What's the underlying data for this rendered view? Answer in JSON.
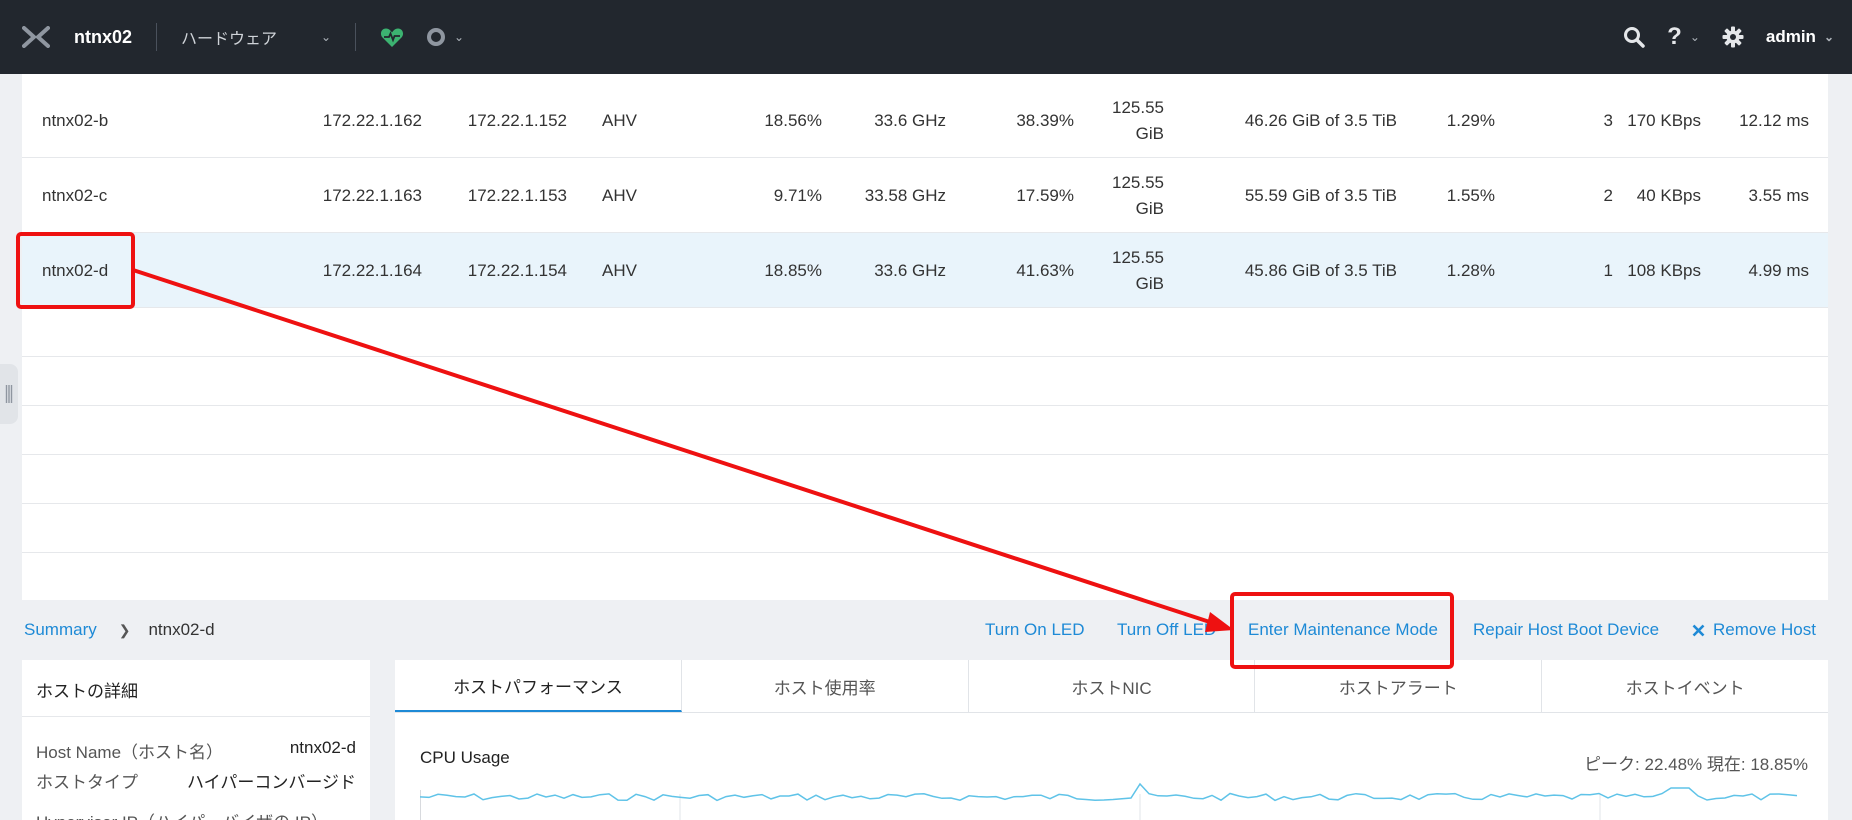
{
  "topbar": {
    "cluster_name": "ntnx02",
    "entity_menu": "ハードウェア",
    "user": "admin",
    "icons": [
      "nutanix-logo",
      "health-heart-icon",
      "alert-circle-icon",
      "search-icon",
      "help-icon",
      "gear-icon"
    ]
  },
  "hosts": [
    {
      "name": "ntnx02-b",
      "hypervisor_ip": "172.22.1.162",
      "cvm_ip": "172.22.1.152",
      "hypervisor": "AHV",
      "cpu_usage": "18.56%",
      "cpu_capacity": "33.6 GHz",
      "memory_usage": "38.39%",
      "memory_capacity_1": "125.55",
      "memory_capacity_2": "GiB",
      "storage": "46.26 GiB of 3.5 TiB",
      "disk_usage": "1.29%",
      "vms": "3",
      "io_bandwidth": "170 KBps",
      "latency": "12.12 ms"
    },
    {
      "name": "ntnx02-c",
      "hypervisor_ip": "172.22.1.163",
      "cvm_ip": "172.22.1.153",
      "hypervisor": "AHV",
      "cpu_usage": "9.71%",
      "cpu_capacity": "33.58 GHz",
      "memory_usage": "17.59%",
      "memory_capacity_1": "125.55",
      "memory_capacity_2": "GiB",
      "storage": "55.59 GiB of 3.5 TiB",
      "disk_usage": "1.55%",
      "vms": "2",
      "io_bandwidth": "40 KBps",
      "latency": "3.55 ms"
    },
    {
      "name": "ntnx02-d",
      "hypervisor_ip": "172.22.1.164",
      "cvm_ip": "172.22.1.154",
      "hypervisor": "AHV",
      "cpu_usage": "18.85%",
      "cpu_capacity": "33.6 GHz",
      "memory_usage": "41.63%",
      "memory_capacity_1": "125.55",
      "memory_capacity_2": "GiB",
      "storage": "45.86 GiB of 3.5 TiB",
      "disk_usage": "1.28%",
      "vms": "1",
      "io_bandwidth": "108 KBps",
      "latency": "4.99 ms"
    }
  ],
  "breadcrumb": {
    "root": "Summary",
    "current": "ntnx02-d"
  },
  "actions": {
    "turn_on_led": "Turn On LED",
    "turn_off_led": "Turn Off LED",
    "enter_maintenance": "Enter Maintenance Mode",
    "repair_boot": "Repair Host Boot Device",
    "remove_host": "Remove Host"
  },
  "details": {
    "title": "ホストの詳細",
    "rows": [
      {
        "key": "Host Name（ホスト名）",
        "value": "ntnx02-d"
      },
      {
        "key": "ホストタイプ",
        "value": "ハイパーコンバージド"
      },
      {
        "key": "Hypervisor IP（ハイパーバイザの IP）",
        "value": ""
      }
    ]
  },
  "perf": {
    "tabs": [
      "ホストパフォーマンス",
      "ホスト使用率",
      "ホストNIC",
      "ホストアラート",
      "ホストイベント"
    ],
    "cpu_title": "CPU Usage",
    "cpu_stats": "ピーク: 22.48%   現在: 18.85%",
    "cpu_peak_percent": 22.48,
    "cpu_current_percent": 18.85
  },
  "colors": {
    "accent": "#1e8ad6",
    "topbar": "#22272e",
    "health": "#3cb371",
    "annotation": "#ee1111",
    "selected_row": "#e9f4fb"
  }
}
